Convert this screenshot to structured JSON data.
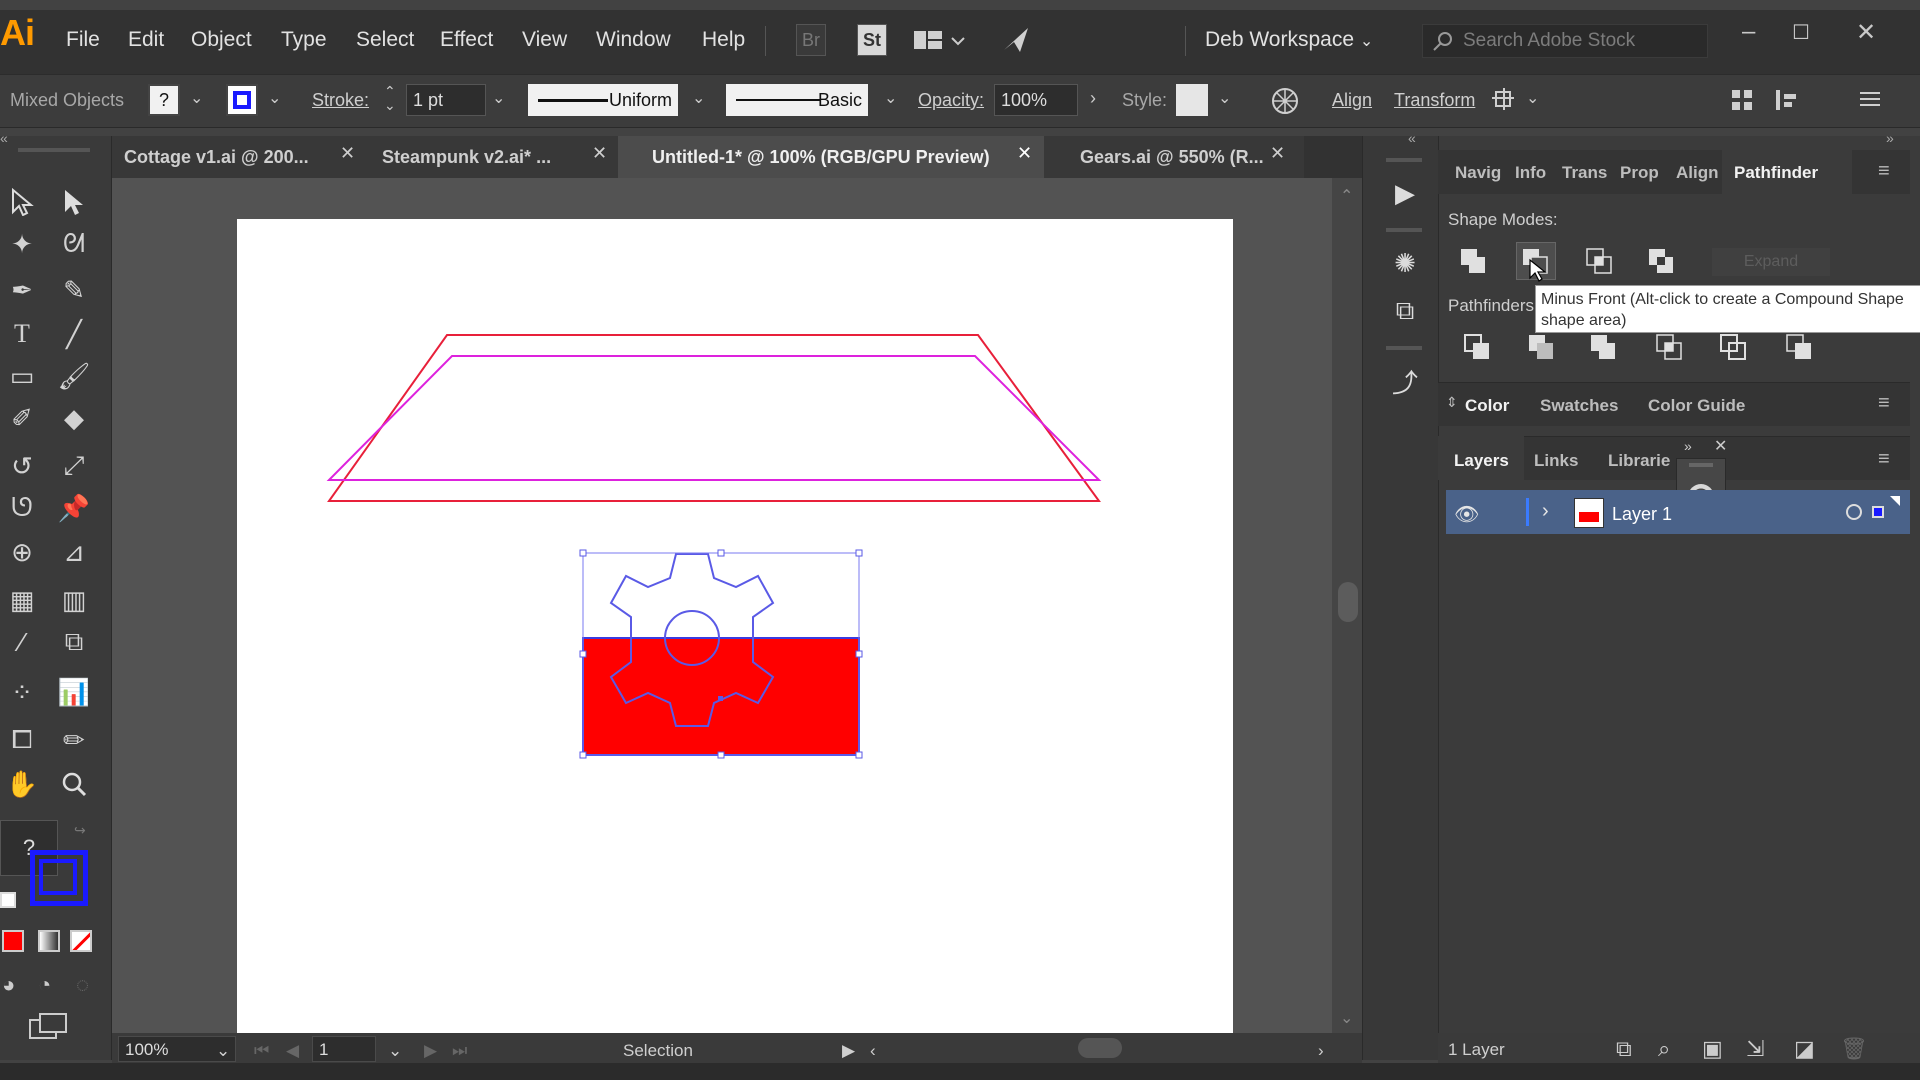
{
  "app": {
    "logo": "Ai",
    "workspace": "Deb Workspace",
    "stock_placeholder": "Search Adobe Stock"
  },
  "menu": [
    "File",
    "Edit",
    "Object",
    "Type",
    "Select",
    "Effect",
    "View",
    "Window",
    "Help"
  ],
  "bridge_labels": {
    "br": "Br",
    "st": "St"
  },
  "control": {
    "selection_type": "Mixed Objects",
    "fill_q": "?",
    "stroke_label": "Stroke:",
    "stroke_value": "1 pt",
    "profile": "Uniform",
    "brush": "Basic",
    "opacity_label": "Opacity:",
    "opacity_value": "100%",
    "style_label": "Style:",
    "align": "Align",
    "transform": "Transform"
  },
  "tabs": [
    {
      "label": "Cottage v1.ai @ 200...",
      "active": false
    },
    {
      "label": "Steampunk v2.ai* ...",
      "active": false
    },
    {
      "label": "Untitled-1* @ 100% (RGB/GPU Preview)",
      "active": true
    },
    {
      "label": "Gears.ai @ 550% (R...",
      "active": false
    }
  ],
  "toolbar": {
    "question": "?"
  },
  "status": {
    "zoom": "100%",
    "artboard": "1",
    "tool": "Selection"
  },
  "panels": {
    "top_tabs": [
      "Navig",
      "Info",
      "Trans",
      "Prop",
      "Align",
      "Pathfinder"
    ],
    "shape_modes_label": "Shape Modes:",
    "expand": "Expand",
    "pathfinders_label": "Pathfinders",
    "tooltip_line1": "Minus Front (Alt-click to create a Compound Shape",
    "tooltip_line2": "shape area)",
    "color_tabs": [
      "Color",
      "Swatches",
      "Color Guide"
    ],
    "layer_tabs": [
      "Layers",
      "Links",
      "Librarie"
    ],
    "layer_name": "Layer 1",
    "layer_count": "1 Layer"
  },
  "colors": {
    "accent_blue": "#1a1aff",
    "shape_red": "#ff0000",
    "layer_sel": "#4a6289"
  }
}
